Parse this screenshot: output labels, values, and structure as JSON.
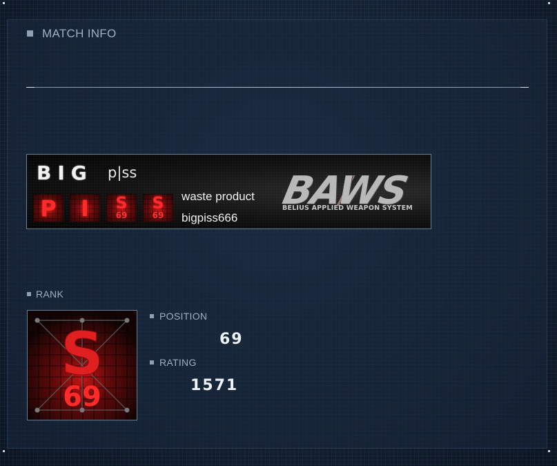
{
  "match_info": {
    "title": "MATCH INFO"
  },
  "emblem": {
    "big_text": "BIG",
    "small_text": "p|ss",
    "tiles": [
      {
        "letter": "P",
        "number": ""
      },
      {
        "letter": "I",
        "number": ""
      },
      {
        "letter": "S",
        "number": "69"
      },
      {
        "letter": "S",
        "number": "69"
      }
    ]
  },
  "pilot": {
    "title": "waste product",
    "name": "bigpiss666"
  },
  "corporation": {
    "logo_text": "BAWS",
    "full_name": "BELIUS APPLIED WEAPON SYSTEM"
  },
  "rank": {
    "section_label": "RANK",
    "badge_letter": "S",
    "badge_number": "69",
    "position_label": "POSITION",
    "position_value": "69",
    "rating_label": "RATING",
    "rating_value": "1571"
  },
  "colors": {
    "accent_red": "#ff2a2a",
    "label_gray": "#9fb0c4",
    "value_white": "#eef3f9",
    "panel_bg": "#142133"
  },
  "icons": [
    "section-square-icon",
    "rank-badge-icon"
  ]
}
